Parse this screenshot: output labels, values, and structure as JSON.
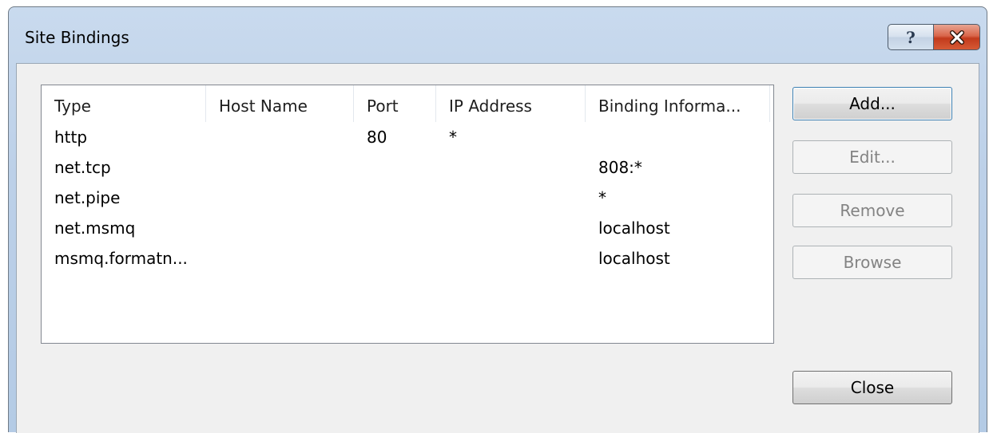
{
  "dialog": {
    "title": "Site Bindings"
  },
  "title_bar": {
    "help_label": "?",
    "icons": [
      "help-icon",
      "close-icon"
    ],
    "close_color": "#c6381b"
  },
  "partial_text": {
    "top": ""
  },
  "list": {
    "columns": [
      "Type",
      "Host Name",
      "Port",
      "IP Address",
      "Binding Informa..."
    ],
    "rows": [
      {
        "type": "http",
        "host": "",
        "port": "80",
        "ip": "*",
        "binding": ""
      },
      {
        "type": "net.tcp",
        "host": "",
        "port": "",
        "ip": "",
        "binding": "808:*"
      },
      {
        "type": "net.pipe",
        "host": "",
        "port": "",
        "ip": "",
        "binding": "*"
      },
      {
        "type": "net.msmq",
        "host": "",
        "port": "",
        "ip": "",
        "binding": "localhost"
      },
      {
        "type": "msmq.formatn...",
        "host": "",
        "port": "",
        "ip": "",
        "binding": "localhost"
      }
    ]
  },
  "buttons": {
    "add": "Add...",
    "edit": "Edit...",
    "remove": "Remove",
    "browse": "Browse",
    "close": "Close"
  },
  "colors": {
    "frame": "#bcd0e8",
    "client": "#f0f0f0",
    "default_button_border": "#3c7fb1",
    "disabled_text": "#838383"
  }
}
